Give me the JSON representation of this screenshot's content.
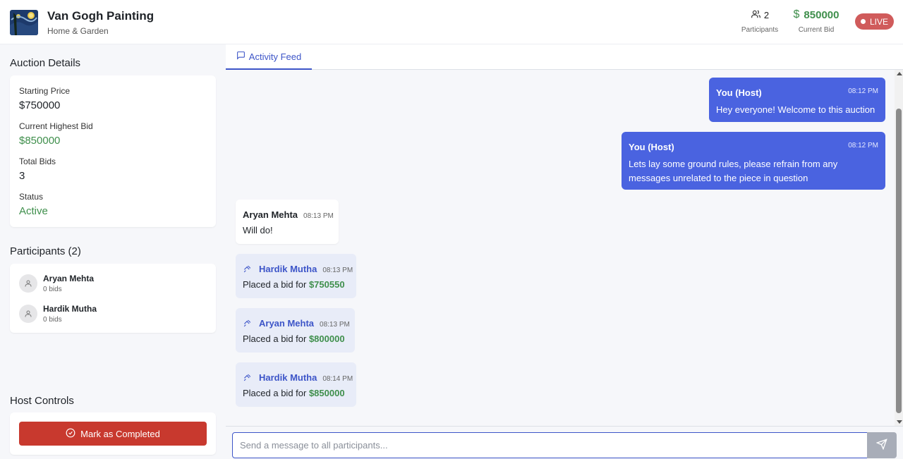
{
  "header": {
    "title": "Van Gogh Painting",
    "category": "Home & Garden",
    "participants_count": "2",
    "participants_caption": "Participants",
    "current_bid_value": "850000",
    "current_bid_symbol": "$",
    "current_bid_caption": "Current Bid",
    "live_label": "LIVE"
  },
  "sidebar": {
    "details_title": "Auction Details",
    "details": {
      "starting_price_label": "Starting Price",
      "starting_price": "$750000",
      "current_highest_label": "Current Highest Bid",
      "current_highest": "$850000",
      "total_bids_label": "Total Bids",
      "total_bids": "3",
      "status_label": "Status",
      "status": "Active"
    },
    "participants_title": "Participants (2)",
    "participants": [
      {
        "name": "Aryan Mehta",
        "bids": "0 bids"
      },
      {
        "name": "Hardik Mutha",
        "bids": "0 bids"
      }
    ],
    "host_controls_title": "Host Controls",
    "mark_completed_label": "Mark as Completed"
  },
  "main": {
    "tab_label": "Activity Feed",
    "messages": [
      {
        "author": "You (Host)",
        "time": "08:12 PM",
        "text": "Hey everyone! Welcome to this auction"
      },
      {
        "author": "You (Host)",
        "time": "08:12 PM",
        "text": "Lets lay some ground rules, please refrain from any messages unrelated to the piece in question"
      },
      {
        "author": "Aryan Mehta",
        "time": "08:13 PM",
        "text": "Will do!"
      },
      {
        "author": "Hardik Mutha",
        "time": "08:13 PM",
        "prefix": "Placed a bid for ",
        "amount": "$750550"
      },
      {
        "author": "Aryan Mehta",
        "time": "08:13 PM",
        "prefix": "Placed a bid for ",
        "amount": "$800000"
      },
      {
        "author": "Hardik Mutha",
        "time": "08:14 PM",
        "prefix": "Placed a bid for ",
        "amount": "$850000"
      }
    ],
    "input_placeholder": "Send a message to all participants..."
  },
  "colors": {
    "accent": "#4a63e0",
    "success": "#3f8f4c",
    "danger": "#c8392e",
    "live": "#d05b5b"
  },
  "icons": [
    "users-icon",
    "dollar-icon",
    "live-dot-icon",
    "message-square-icon",
    "user-icon",
    "check-circle-icon",
    "hammer-icon",
    "send-icon"
  ]
}
